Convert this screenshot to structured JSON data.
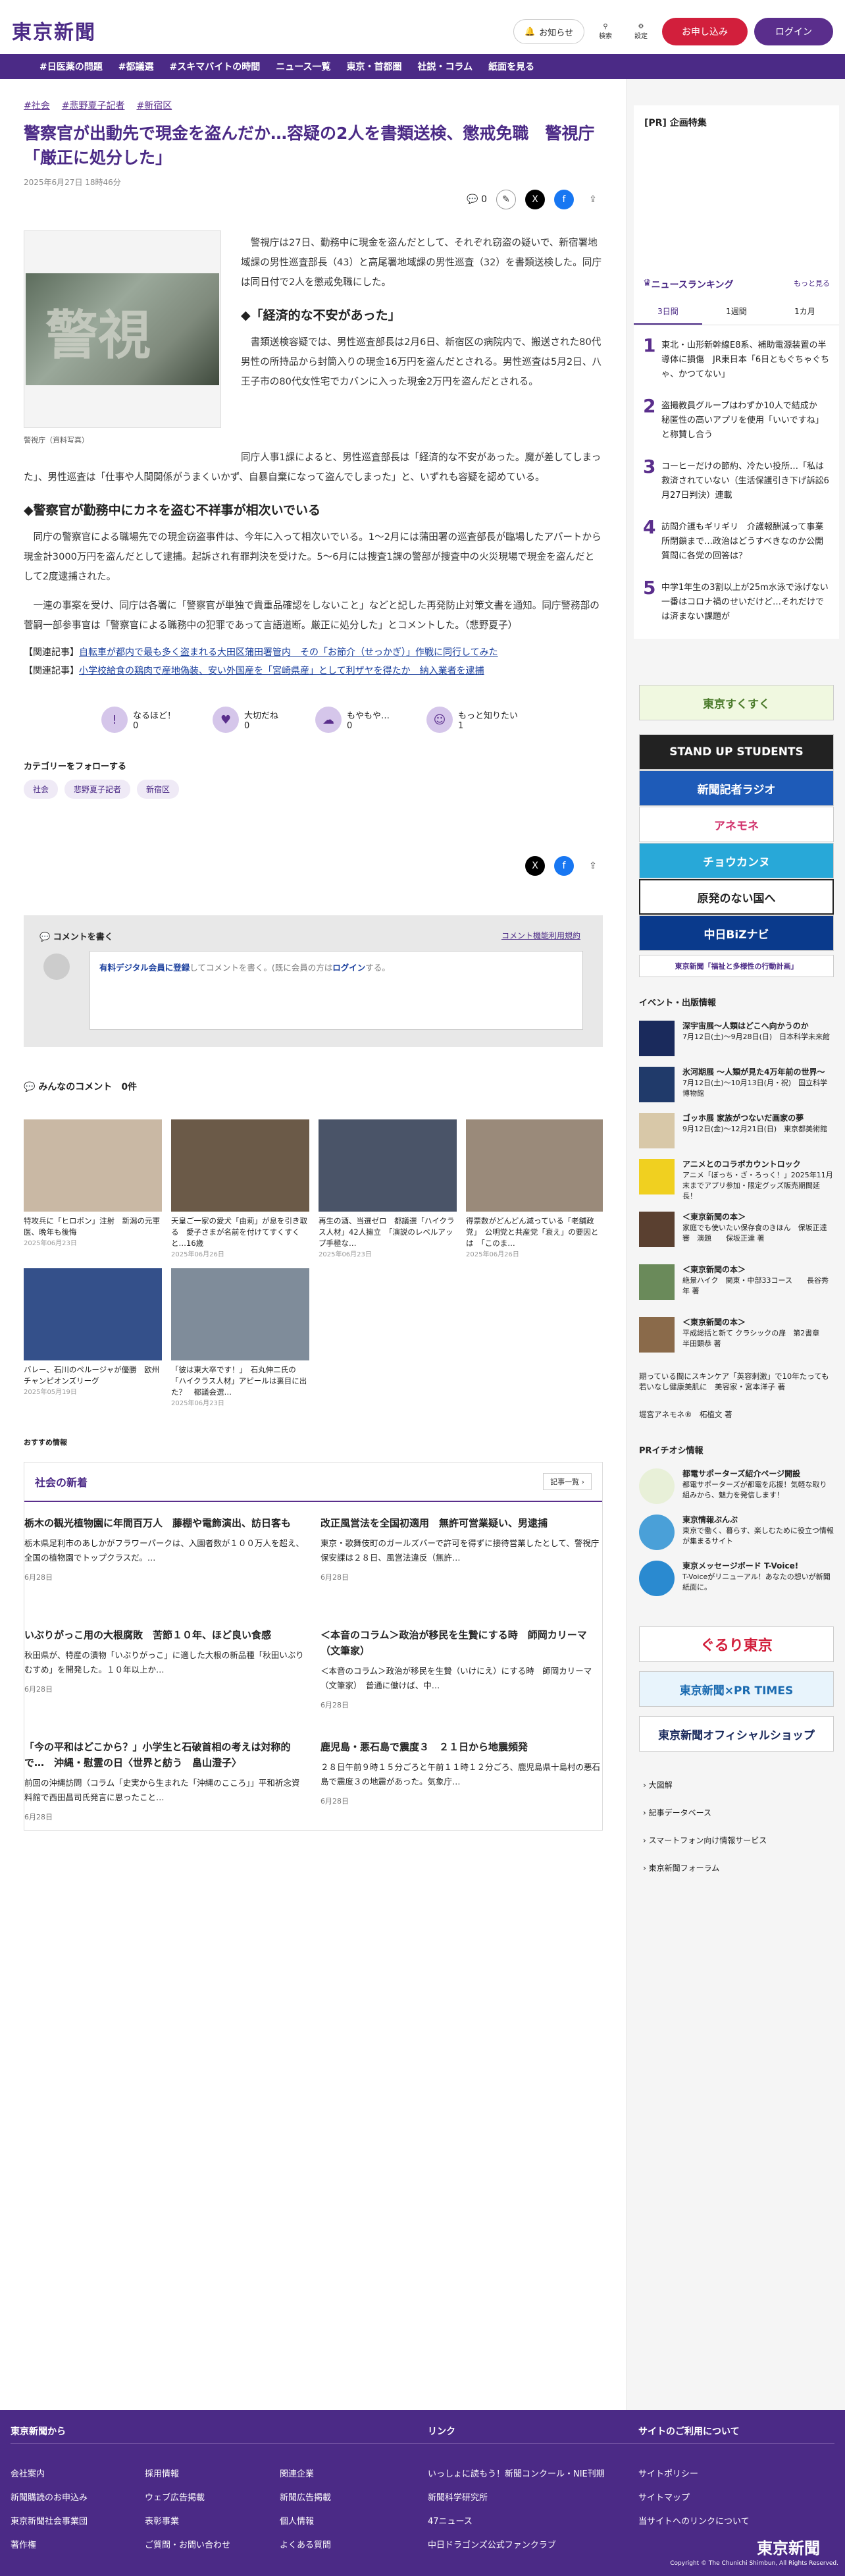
{
  "header": {
    "logo": "東京新聞",
    "notify": "お知らせ",
    "search": "検索",
    "settings": "設定",
    "subscribe": "お申し込み",
    "login": "ログイン"
  },
  "nav": [
    "#日医薬の問題",
    "#都議選",
    "#スキマバイトの時間",
    "ニュース一覧",
    "東京・首都圏",
    "社説・コラム",
    "紙面を見る"
  ],
  "article": {
    "tags": [
      "#社会",
      "#悲野夏子記者",
      "#新宿区"
    ],
    "title": "警察官が出動先で現金を盗んだか…容疑の2人を書類送検、懲戒免職　警視庁「厳正に処分した」",
    "date": "2025年6月27日 18時46分",
    "comment_count": "0",
    "caption": "警視庁（資料写真）",
    "p1": "警視庁は27日、勤務中に現金を盗んだとして、それぞれ窃盗の疑いで、新宿署地域課の男性巡査部長（43）と高尾署地域課の男性巡査（32）を書類送検した。同庁は同日付で2人を懲戒免職にした。",
    "h1": "◆「経済的な不安があった」",
    "p2": "書類送検容疑では、男性巡査部長は2月6日、新宿区の病院内で、搬送された80代男性の所持品から封筒入りの現金16万円を盗んだとされる。男性巡査は5月2日、八王子市の80代女性宅でカバンに入った現金2万円を盗んだとされる。",
    "p3": "同庁人事1課によると、男性巡査部長は「経済的な不安があった。魔が差してしまった」、男性巡査は「仕事や人間関係がうまくいかず、自暴自棄になって盗んでしまった」と、いずれも容疑を認めている。",
    "h2": "◆警察官が勤務中にカネを盗む不祥事が相次いでいる",
    "p4": "同庁の警察官による職場先での現金窃盗事件は、今年に入って相次いでいる。1〜2月には蒲田署の巡査部長が臨場したアパートから現金計3000万円を盗んだとして逮捕。起訴され有罪判決を受けた。5〜6月には捜査1課の警部が捜査中の火災現場で現金を盗んだとして2度逮捕された。",
    "p5": "一連の事案を受け、同庁は各署に「警察官が単独で貴重品確認をしないこと」などと記した再発防止対策文書を通知。同庁警務部の菅嗣一部参事官は「警察官による職務中の犯罪であって言語道断。厳正に処分した」とコメントした。（悲野夏子）",
    "rel1_label": "【関連記事】",
    "rel1": "自転車が都内で最も多く盗まれる大田区蒲田署管内　その「お節介（せっかぎ）」作戦に同行してみた",
    "rel2_label": "【関連記事】",
    "rel2": "小学校給食の鶏肉で産地偽装、安い外国産を「宮崎県産」として利ザヤを得たか　納入業者を逮捕",
    "reactions": [
      {
        "label": "なるほど！",
        "count": "0"
      },
      {
        "label": "大切だね",
        "count": "0"
      },
      {
        "label": "もやもや…",
        "count": "0"
      },
      {
        "label": "もっと知りたい",
        "count": "1"
      }
    ],
    "follow_label": "カテゴリーをフォローする",
    "follow_tags": [
      "社会",
      "悲野夏子記者",
      "新宿区"
    ]
  },
  "comments": {
    "write": "コメントを書く",
    "policy": "コメント機能利用規約",
    "prompt_link": "有料デジタル会員に登録",
    "prompt_mid": "してコメントを書く。(既に会員の方は",
    "prompt_login": "ログイン",
    "prompt_end": "する。",
    "list_title": "みんなのコメント",
    "list_count": "0件"
  },
  "recommend": [
    {
      "t": "特攻兵に「ヒロポン」注射　新潟の元軍医、晩年も後悔",
      "d": "2025年06月23日"
    },
    {
      "t": "天皇ご一家の愛犬「由莉」が息を引き取る　愛子さまが名前を付けてすくすくと…16歳",
      "d": "2025年06月26日"
    },
    {
      "t": "再生の酒、当選ゼロ　都議選「ハイクラス人材」42人擁立　「演説のレベルアップ手極な…",
      "d": "2025年06月23日"
    },
    {
      "t": "得票数がどんどん減っている「老舗政党」　公明党と共産党「衰え」の要因とは　「このま…",
      "d": "2025年06月26日"
    },
    {
      "t": "バレー、石川のペルージャが優勝　欧州チャンピオンズリーグ",
      "d": "2025年05月19日"
    },
    {
      "t": "「彼は東大卒です！」　石丸伸二氏の「ハイクラス人材」アピールは裏目に出た？　都議会選…",
      "d": "2025年06月23日"
    }
  ],
  "recommend_label": "おすすめ情報",
  "news": {
    "title": "社会の新着",
    "more": "記事一覧",
    "items": [
      {
        "t": "栃木の観光植物園に年間百万人　藤棚や電飾演出、訪日客も",
        "s": "栃木県足利市のあしかがフラワーパークは、入園者数が１００万人を超え、全国の植物園でトップクラスだ。…",
        "d": "6月28日"
      },
      {
        "t": "改正風営法を全国初適用　無許可営業疑い、男逮捕",
        "s": "東京・歌舞伎町のガールズバーで許可を得ずに接待営業したとして、警視庁保安課は２８日、風営法違反（無許…",
        "d": "6月28日"
      },
      {
        "t": "いぶりがっこ用の大根腐敗　苦節１０年、ほど良い食感",
        "s": "秋田県が、特産の漬物「いぶりがっこ」に適した大根の新品種「秋田いぶりむすめ」を開発した。１０年以上か…",
        "d": "6月28日"
      },
      {
        "t": "＜本音のコラム＞政治が移民を生贄にする時　師岡カリーマ（文筆家）",
        "s": "＜本音のコラム＞政治が移民を生贄（いけにえ）にする時　師岡カリーマ（文筆家）　普通に働けば、中…",
        "d": "6月28日"
      },
      {
        "t": "「今の平和はどこから？」小学生と石破首相の考えは対称的で…　沖縄・慰霊の日〈世界と舫う　畠山澄子〉",
        "s": "前回の沖縄訪問（コラム「史実から生まれた「沖縄のこころ」」平和祈念資料館で西田昌司氏発言に思ったこと…",
        "d": "6月28日"
      },
      {
        "t": "鹿児島・悪石島で震度３　２１日から地震頻発",
        "s": "２８日午前９時１５分ごろと午前１１時１２分ごろ、鹿児島県十島村の悪石島で震度３の地震があった。気象庁…",
        "d": "6月28日"
      }
    ]
  },
  "side": {
    "pr": "[PR] 企画特集",
    "ranking_title": "ニュースランキング",
    "ranking_more": "もっと見る",
    "ranking_tabs": [
      "3日間",
      "1週間",
      "1カ月"
    ],
    "ranking": [
      "東北・山形新幹線E8系、補助電源装置の半導体に損傷　JR東日本「6日ともぐちゃぐちゃ、かつてない」",
      "盗撮教員グループはわずか10人で結成か　秘匿性の高いアプリを使用「いいですね」と称賛し合う",
      "コーヒーだけの節約、冷たい投所…「私は救済されていない（生活保護引き下げ訴訟6月27日判決）連載",
      "訪問介護もギリギリ　介護報酬減って事業所閉鎖まで…政治はどうすべきなのか公開質問に各党の回答は？",
      "中学1年生の3割以上が25m水泳で泳げない　一番はコロナ禍のせいだけど…それだけでは済まない課題が"
    ],
    "banners": [
      "東京すくすく",
      "STAND UP STUDENTS",
      "新聞記者ラジオ",
      "アネモネ",
      "チョウカンヌ",
      "原発のない国へ",
      "中日BiZナビ",
      "東京新聞「福祉と多様性の行動計画」"
    ],
    "events_title": "イベント・出版情報",
    "events": [
      {
        "t": "深宇宙展〜人類はどこへ向かうのか",
        "s": "7月12日(土)〜9月28日(日)　日本科学未来館"
      },
      {
        "t": "氷河期展 〜人類が見た4万年前の世界〜",
        "s": "7月12日(土)〜10月13日(月・祝)　国立科学博物館"
      },
      {
        "t": "ゴッホ展 家族がつないだ画家の夢",
        "s": "9月12日(金)〜12月21日(日)　東京都美術館"
      },
      {
        "t": "アニメとのコラボカウントロック",
        "s": "アニメ「ぼっち・ざ・ろっく！」2025年11月末までアプリ参加・限定グッズ販売期間延長！"
      },
      {
        "t": "＜東京新聞の本＞",
        "s": "家庭でも使いたい保存食のきほん　保坂正達審　演題　　保坂正達 著"
      },
      {
        "t": "＜東京新聞の本＞",
        "s": "絶景ハイク　関東・中部33コース　　長谷秀年 著"
      },
      {
        "t": "＜東京新聞の本＞",
        "s": "平成総括と新て クラシックの扉　第2書章　半田顕恭 著"
      }
    ],
    "ev_text1": "期っている間にスキンケア「英容刺激」で10年たっても若いなし健康美肌に　美容家・宮本洋子 著",
    "ev_text2": "堀宮アネモネ®　柘植文 著",
    "pr2_title": "PRイチオシ情報",
    "pr2": [
      {
        "t": "都電サポーターズ紹介ページ開設",
        "s": "都電サポーターズが都電を応援！気軽な取り組みから、魅力を発信します！"
      },
      {
        "t": "東京情報ぶんぶ",
        "s": "東京で働く、暮らす、楽しむために役立つ情報が集まるサイト"
      },
      {
        "t": "東京メッセージボード T-Voice!",
        "s": "T-Voiceがリニューアル！あなたの想いが新聞紙面に。"
      }
    ],
    "banners2": [
      "ぐるり東京",
      "東京新聞×PR TIMES",
      "東京新聞オフィシャルショップ"
    ],
    "links": [
      "大図解",
      "記事データベース",
      "スマートフォン向け情報サービス",
      "東京新聞フォーラム"
    ]
  },
  "footer": {
    "col1": "東京新聞から",
    "col2": "リンク",
    "col3": "サイトのご利用について",
    "c1a": [
      "会社案内",
      "新聞購読のお申込み",
      "東京新聞社会事業団",
      "著作権"
    ],
    "c1b": [
      "採用情報",
      "ウェブ広告掲載",
      "表彰事業",
      "ご質問・お問い合わせ"
    ],
    "c1c": [
      "関連企業",
      "新聞広告掲載",
      "個人情報",
      "よくある質問"
    ],
    "c2": [
      "いっしょに読もう！新聞コンクール・NIE刊期",
      "新聞科学研究所",
      "47ニュース",
      "中日ドラゴンズ公式ファンクラブ"
    ],
    "c3": [
      "サイトポリシー",
      "サイトマップ",
      "当サイトへのリンクについて"
    ],
    "logo": "東京新聞",
    "copy": "Copyright © The Chunichi Shimbun, All Rights Reserved."
  }
}
